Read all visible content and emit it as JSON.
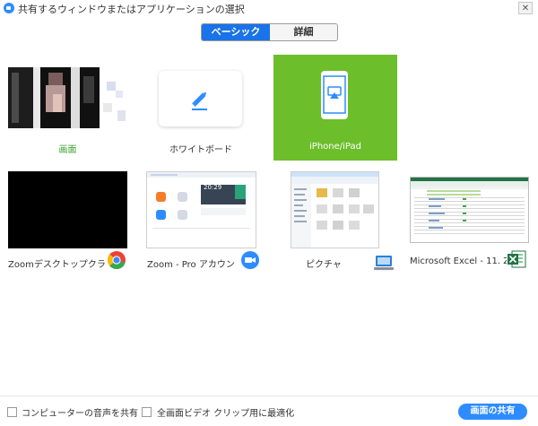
{
  "window": {
    "title": "共有するウィンドウまたはアプリケーションの選択",
    "close_glyph": "✕"
  },
  "tabs": {
    "basic_label": "ベーシック",
    "detail_label": "詳細",
    "active": "basic"
  },
  "tiles": {
    "screen": {
      "label": "画面"
    },
    "whiteboard": {
      "label": "ホワイトボード",
      "icon": "pencil-icon"
    },
    "iphone": {
      "label": "iPhone/iPad",
      "icon": "airplay-phone-icon",
      "selected": true
    },
    "zoom_desktop": {
      "label": "Zoomデスクトップクラ…",
      "badge_icon": "chrome-icon"
    },
    "zoom_pro": {
      "label": "Zoom - Pro アカウント",
      "badge_icon": "zoom-video-icon",
      "thumb_time": "20:29"
    },
    "picture": {
      "label": "ピクチャ",
      "badge_icon": "computer-picture-icon"
    },
    "excel": {
      "label": "Microsoft Excel - 11. Zoo…",
      "badge_icon": "excel-icon"
    }
  },
  "footer": {
    "computer_audio_label": "コンピューターの音声を共有",
    "fullscreen_video_label": "全画面ビデオ クリップ用に最適化",
    "share_button_label": "画面の共有"
  },
  "colors": {
    "accent_blue": "#2d8cff",
    "tab_blue": "#1a73e8",
    "selected_green": "#6cbe2b",
    "screen_label_green": "#3aa02d"
  }
}
